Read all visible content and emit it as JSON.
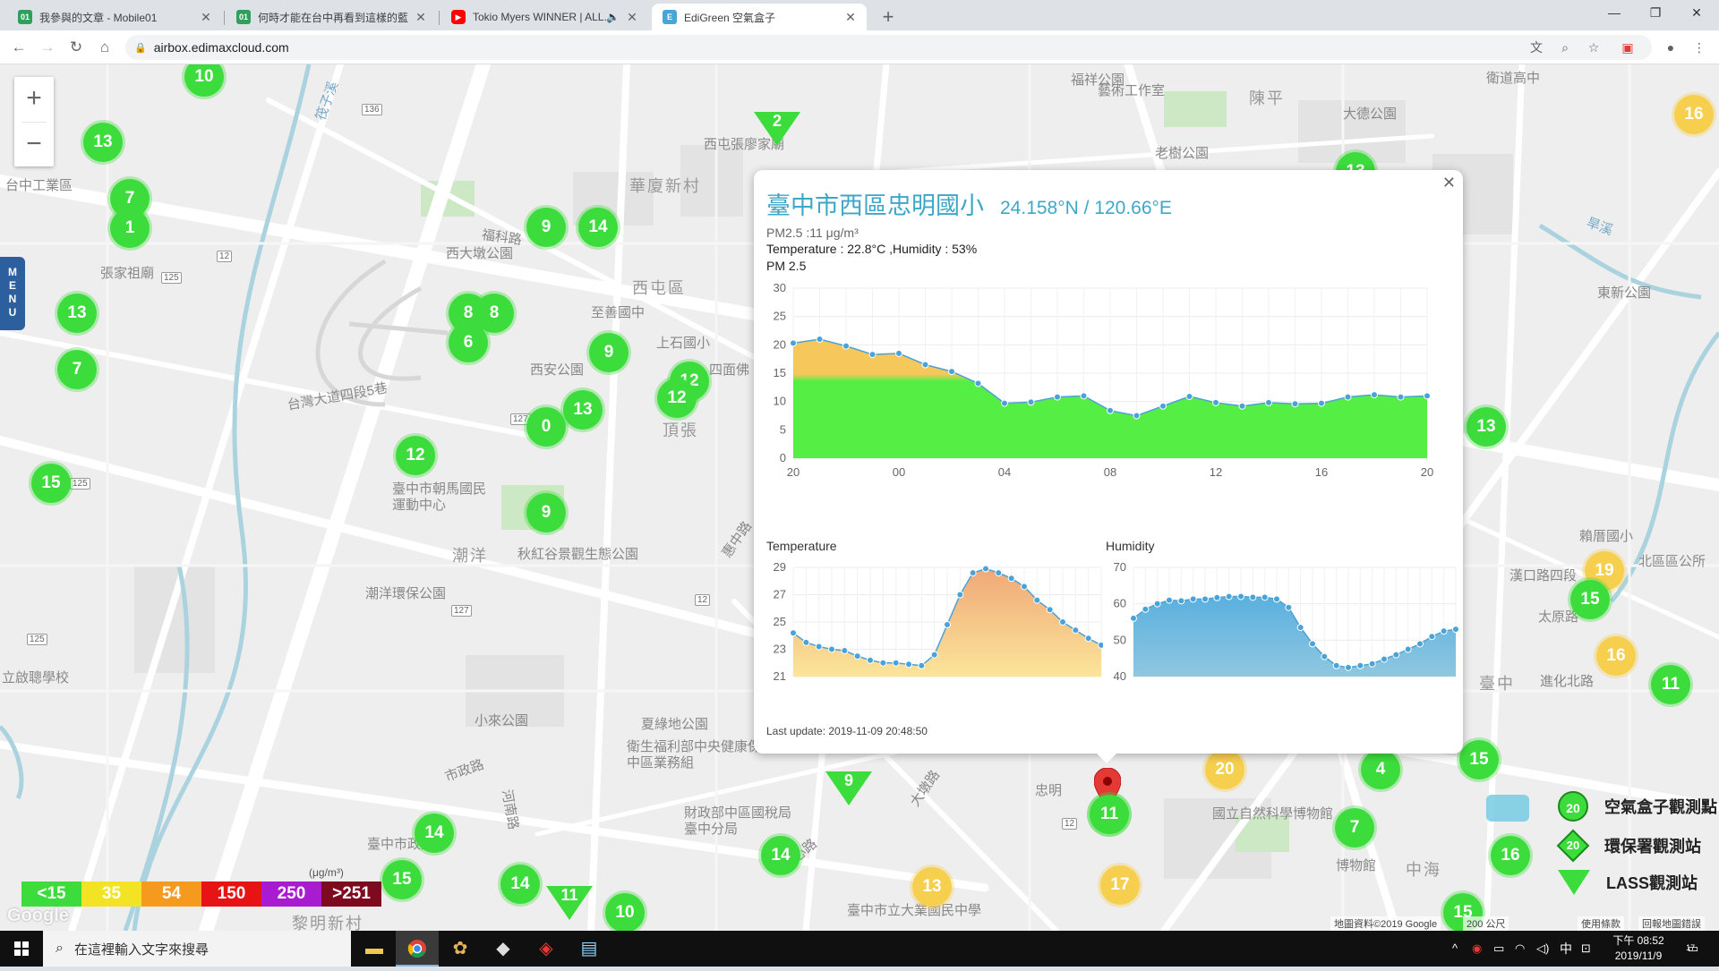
{
  "browser": {
    "tabs": [
      {
        "title": "我參與的文章 - Mobile01",
        "favicon_color": "#2ea05c"
      },
      {
        "title": "何時才能在台中再看到這樣的藍天...",
        "favicon_color": "#2ea05c"
      },
      {
        "title": "Tokio Myers WINNER | ALL...",
        "favicon_color": "#ff0000"
      },
      {
        "title": "EdiGreen 空氣盒子",
        "favicon_color": "#46a7d6"
      }
    ],
    "url": "airbox.edimaxcloud.com"
  },
  "map": {
    "district_labels": [
      "華廈新村",
      "西屯區",
      "潮洋",
      "頂張",
      "陳平",
      "臺中",
      "中海"
    ],
    "place_labels": [
      "西大墩公園",
      "西安公園",
      "至善國中",
      "上石國小",
      "四面佛",
      "臺中市朝馬國民運動中心",
      "秋紅谷景觀生態公園",
      "潮洋環保公園",
      "小來公園",
      "夏綠地公園",
      "衛生福利部中央健康保險署中區業務組",
      "財政部中區國稅局臺中分局",
      "臺中市政府",
      "國立自然科學博物館",
      "台中工業區",
      "張家祖廟",
      "西屯張廖家廟",
      "老樹公園",
      "大德公園",
      "衛道高中",
      "東新公園",
      "賴厝國小",
      "北區區公所",
      "漢口路四段",
      "太原路",
      "進化北路",
      "博物館",
      "臺中市立大業國民中學",
      "黎明新村",
      "市政路",
      "福科路",
      "河南路",
      "惠中路",
      "文心路",
      "大墩路",
      "台灣大道四段5巷",
      "福祥公園",
      "筏子溪",
      "旱溪",
      "藝術工作室",
      "立啟聰學校",
      "忠明"
    ],
    "shields": [
      "125",
      "127",
      "12",
      "136"
    ],
    "clusters": [
      {
        "v": "10",
        "c": "green"
      },
      {
        "v": "13",
        "c": "green"
      },
      {
        "v": "7",
        "c": "green"
      },
      {
        "v": "1",
        "c": "green"
      },
      {
        "v": "13",
        "c": "green"
      },
      {
        "v": "7",
        "c": "green"
      },
      {
        "v": "15",
        "c": "green"
      },
      {
        "v": "9",
        "c": "green"
      },
      {
        "v": "14",
        "c": "green"
      },
      {
        "v": "8",
        "c": "green"
      },
      {
        "v": "8",
        "c": "green"
      },
      {
        "v": "6",
        "c": "green"
      },
      {
        "v": "9",
        "c": "green"
      },
      {
        "v": "12",
        "c": "green"
      },
      {
        "v": "12",
        "c": "green"
      },
      {
        "v": "13",
        "c": "green"
      },
      {
        "v": "0",
        "c": "green"
      },
      {
        "v": "12",
        "c": "green"
      },
      {
        "v": "9",
        "c": "green"
      },
      {
        "v": "14",
        "c": "green"
      },
      {
        "v": "15",
        "c": "green"
      },
      {
        "v": "14",
        "c": "green"
      },
      {
        "v": "10",
        "c": "green"
      },
      {
        "v": "14",
        "c": "green"
      },
      {
        "v": "13",
        "c": "yellow"
      },
      {
        "v": "11",
        "c": "green"
      },
      {
        "v": "20",
        "c": "yellow"
      },
      {
        "v": "4",
        "c": "green"
      },
      {
        "v": "15",
        "c": "green"
      },
      {
        "v": "7",
        "c": "green"
      },
      {
        "v": "17",
        "c": "yellow"
      },
      {
        "v": "13",
        "c": "green"
      },
      {
        "v": "16",
        "c": "yellow"
      },
      {
        "v": "19",
        "c": "yellow"
      },
      {
        "v": "15",
        "c": "green"
      },
      {
        "v": "16",
        "c": "yellow"
      },
      {
        "v": "11",
        "c": "green"
      },
      {
        "v": "16",
        "c": "green"
      },
      {
        "v": "15",
        "c": "green"
      },
      {
        "v": "13",
        "c": "green"
      }
    ],
    "triangles": [
      "2",
      "9",
      "11"
    ],
    "aqi_scale": [
      {
        "label": "<15",
        "color": "#3ddc3d"
      },
      {
        "label": "35",
        "color": "#f2e324"
      },
      {
        "label": "54",
        "color": "#f59a1f"
      },
      {
        "label": "150",
        "color": "#e61414"
      },
      {
        "label": "250",
        "color": "#a81bd0"
      },
      {
        "label": ">251",
        "color": "#7d0a1e"
      }
    ],
    "scale_unit": "(μg/m³)",
    "google_logo": "Google",
    "attribution": "地圖資料©2019 Google",
    "scale_bar": "200 公尺",
    "terms": "使用條款",
    "report": "回報地圖錯誤",
    "menu_label": "MENU",
    "legend": [
      {
        "label": "空氣盒子觀測點",
        "value": "20"
      },
      {
        "label": "環保署觀測站",
        "value": "20"
      },
      {
        "label": "LASS觀測站",
        "value": "20"
      }
    ]
  },
  "popup": {
    "title": "臺中市西區忠明國小",
    "coords": "24.158°N / 120.66°E",
    "pm25_line": "PM2.5 :11 μg/m³",
    "temp_line": "Temperature : 22.8°C ,Humidity : 53%",
    "pm_chart_label": "PM 2.5",
    "temp_chart_label": "Temperature",
    "hum_chart_label": "Humidity",
    "last_update": "Last update: 2019-11-09 20:48:50",
    "marker_value": "11"
  },
  "chart_data": [
    {
      "type": "area",
      "title": "PM 2.5",
      "x": [
        0,
        1,
        2,
        3,
        4,
        5,
        6,
        7,
        8,
        9,
        10,
        11,
        12,
        13,
        14,
        15,
        16,
        17,
        18,
        19,
        20,
        21,
        22,
        23,
        24
      ],
      "xticks": [
        "20",
        "00",
        "04",
        "08",
        "12",
        "16",
        "20"
      ],
      "values": [
        20.3,
        21,
        19.8,
        18.3,
        18.5,
        16.5,
        15.3,
        13.2,
        9.7,
        9.9,
        10.8,
        11,
        8.4,
        7.5,
        9.2,
        10.9,
        9.8,
        9.2,
        9.8,
        9.6,
        9.7,
        10.8,
        11.2,
        10.8,
        11
      ],
      "ylim": [
        0,
        30
      ],
      "yticks": [
        0,
        5,
        10,
        15,
        20,
        25,
        30
      ]
    },
    {
      "type": "area",
      "title": "Temperature",
      "values": [
        24.2,
        23.5,
        23.2,
        23.0,
        22.9,
        22.5,
        22.2,
        22.0,
        22.0,
        21.9,
        21.8,
        22.6,
        24.8,
        27.0,
        28.6,
        28.9,
        28.6,
        28.2,
        27.6,
        26.6,
        25.9,
        25.0,
        24.4,
        23.8,
        23.3
      ],
      "ylim": [
        21,
        29
      ],
      "yticks": [
        21,
        23,
        25,
        27,
        29
      ]
    },
    {
      "type": "area",
      "title": "Humidity",
      "values": [
        56,
        58.5,
        60,
        61,
        60.8,
        61.3,
        61.3,
        61.7,
        62,
        62,
        61.8,
        61.8,
        61.3,
        59,
        53.5,
        49,
        45.5,
        43,
        42.5,
        43,
        43.5,
        44.8,
        46,
        47.5,
        49,
        51,
        52.5,
        53
      ],
      "ylim": [
        40,
        70
      ],
      "yticks": [
        40,
        50,
        60,
        70
      ]
    }
  ],
  "taskbar": {
    "search_placeholder": "在這裡輸入文字來搜尋",
    "time": "下午 08:52",
    "date": "2019/11/9",
    "ime": "中",
    "notif": "17"
  }
}
